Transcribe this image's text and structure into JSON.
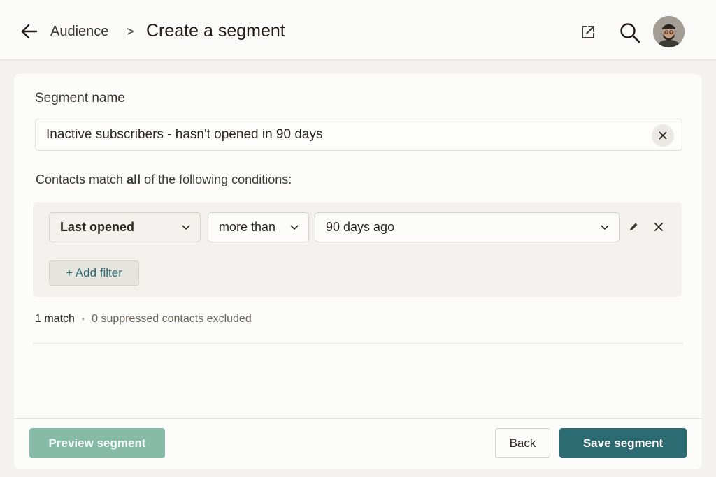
{
  "header": {
    "breadcrumb_parent": "Audience",
    "breadcrumb_separator": ">",
    "title": "Create a segment",
    "icons": [
      "back-arrow-icon",
      "external-link-icon",
      "search-icon",
      "avatar"
    ]
  },
  "segment": {
    "name_label": "Segment name",
    "name_value": "Inactive subscribers - hasn't opened in 90 days",
    "conditions_prefix": "Contacts match ",
    "conditions_match": "all",
    "conditions_suffix": " of the following conditions:"
  },
  "filter": {
    "field": "Last opened",
    "operator": "more than",
    "value": "90 days ago",
    "add_filter_label": "+ Add filter"
  },
  "results": {
    "match_count": "1 match",
    "separator": "•",
    "suppressed": "0 suppressed contacts excluded"
  },
  "footer": {
    "preview_label": "Preview segment",
    "back_label": "Back",
    "save_label": "Save segment"
  },
  "colors": {
    "primary": "#2d6b73",
    "preview_disabled": "#86bba8",
    "background": "#f3f2ee"
  }
}
